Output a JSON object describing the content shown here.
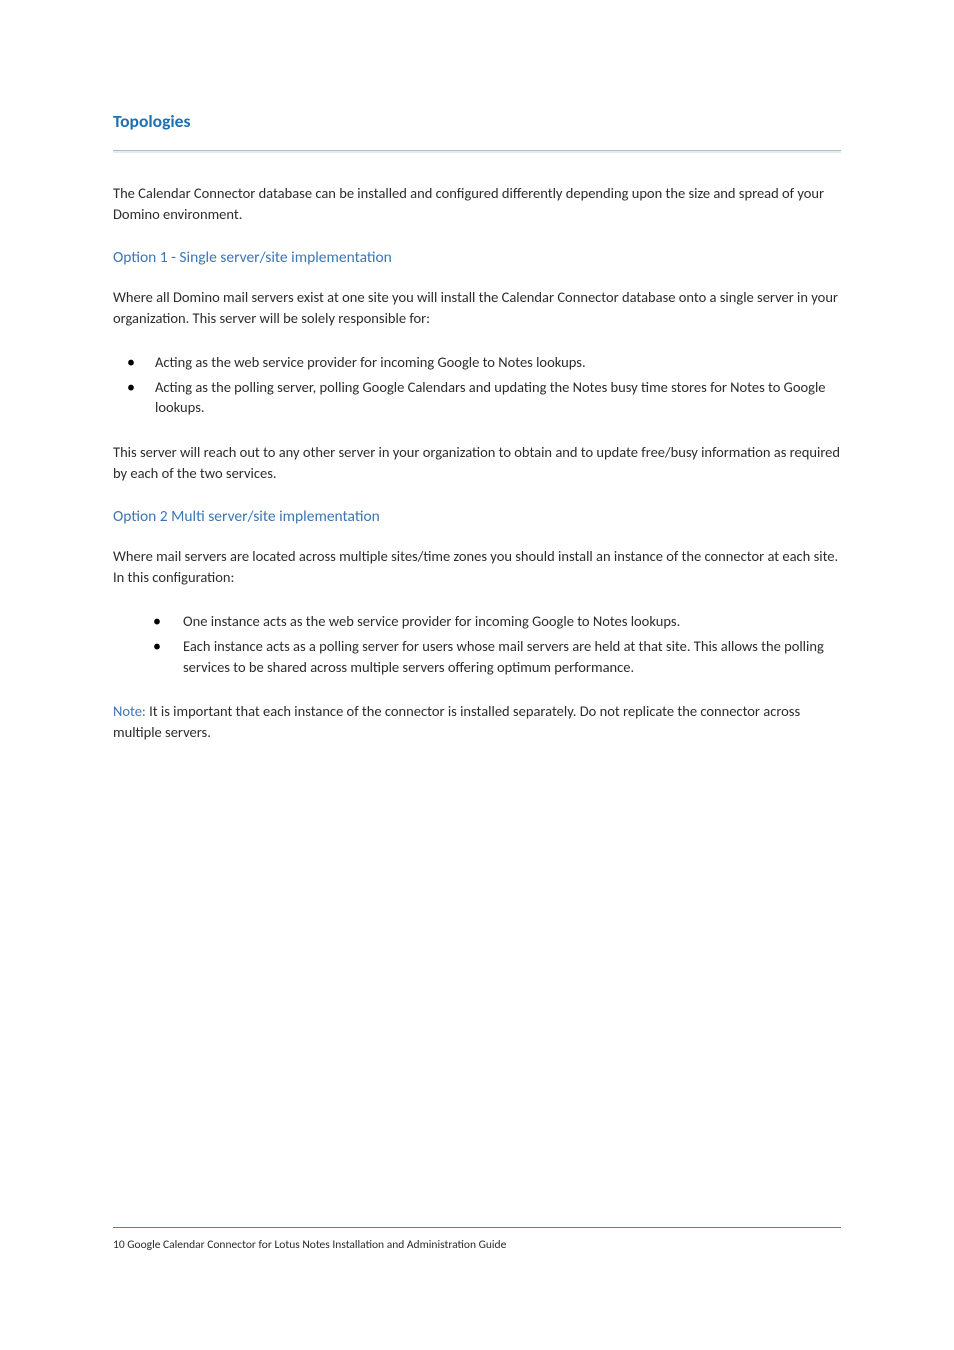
{
  "heading": "Topologies",
  "intro": "The Calendar Connector database can be installed and configured differently depending upon the size and spread of your Domino environment.",
  "option1": {
    "title": "Option 1 - Single server/site implementation",
    "lead": "Where all Domino mail servers exist at one site you will install the Calendar Connector database onto a single server in your organization. This server will be solely responsible for:",
    "bullets": [
      "Acting as the web service provider for incoming Google to Notes lookups.",
      "Acting as the polling server, polling Google Calendars and updating the Notes busy time stores for Notes to Google lookups."
    ],
    "trail": "This server will reach out to any other server in your organization to obtain and to update free/busy information as required by each of the two services."
  },
  "option2": {
    "title": "Option 2 Multi server/site implementation",
    "lead": "Where mail servers are located across multiple sites/time zones you should install an instance of the connector at each site. In this configuration:",
    "bullets": [
      "One instance acts as the web service provider for incoming Google to Notes lookups.",
      "Each instance acts as a polling server for users whose mail servers are held at that site. This allows the polling services to be shared across multiple servers offering optimum performance."
    ]
  },
  "note": {
    "label": "Note:",
    "text": " It is important that each instance of the connector is installed separately. Do not replicate the connector across multiple servers."
  },
  "footer": {
    "page": "10",
    "title": "  Google Calendar Connector for Lotus Notes Installation and Administration Guide"
  }
}
